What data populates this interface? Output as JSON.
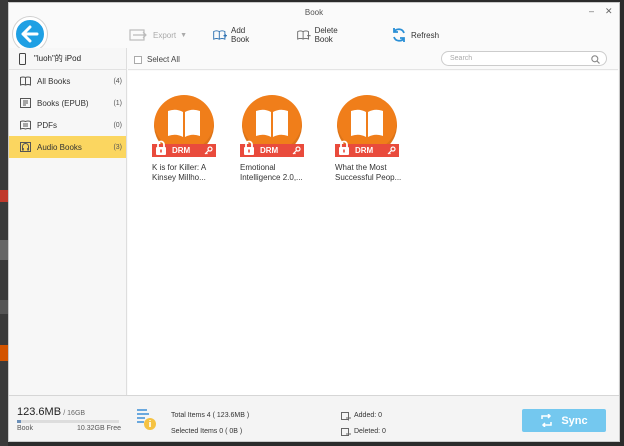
{
  "window": {
    "title": "Book"
  },
  "toolbar": {
    "export_label": "Export",
    "add_label": "Add Book",
    "delete_label": "Delete Book",
    "refresh_label": "Refresh"
  },
  "sidebar": {
    "device": "\"luoh\"的 iPod",
    "items": [
      {
        "label": "All Books",
        "count": "(4)",
        "icon": "book-icon"
      },
      {
        "label": "Books (EPUB)",
        "count": "(1)",
        "icon": "epub-icon"
      },
      {
        "label": "PDFs",
        "count": "(0)",
        "icon": "pdf-icon"
      },
      {
        "label": "Audio Books",
        "count": "(3)",
        "icon": "audiobook-icon",
        "active": true
      }
    ]
  },
  "list": {
    "select_all": "Select All",
    "search_placeholder": "Search"
  },
  "books": [
    {
      "title_line1": "K is for Killer: A",
      "title_line2": "Kinsey Millho...",
      "badge": "DRM"
    },
    {
      "title_line1": "Emotional",
      "title_line2": "Intelligence 2.0,...",
      "badge": "DRM"
    },
    {
      "title_line1": "What the Most",
      "title_line2": "Successful Peop...",
      "badge": "DRM"
    }
  ],
  "footer": {
    "used": "123.6MB",
    "total": "/ 16GB",
    "used_fraction": 0.0075,
    "category": "Book",
    "free": "10.32GB Free",
    "total_items": "Total Items 4 ( 123.6MB )",
    "selected_items": "Selected Items 0 ( 0B )",
    "added": "Added: 0",
    "deleted": "Deleted: 0",
    "sync_label": "Sync"
  },
  "colors": {
    "accent": "#1fa0e4",
    "active_nav": "#fbd660",
    "book_cover": "#f07e1a",
    "drm_badge": "#e94b3c",
    "sync_button": "#74c8ef"
  }
}
